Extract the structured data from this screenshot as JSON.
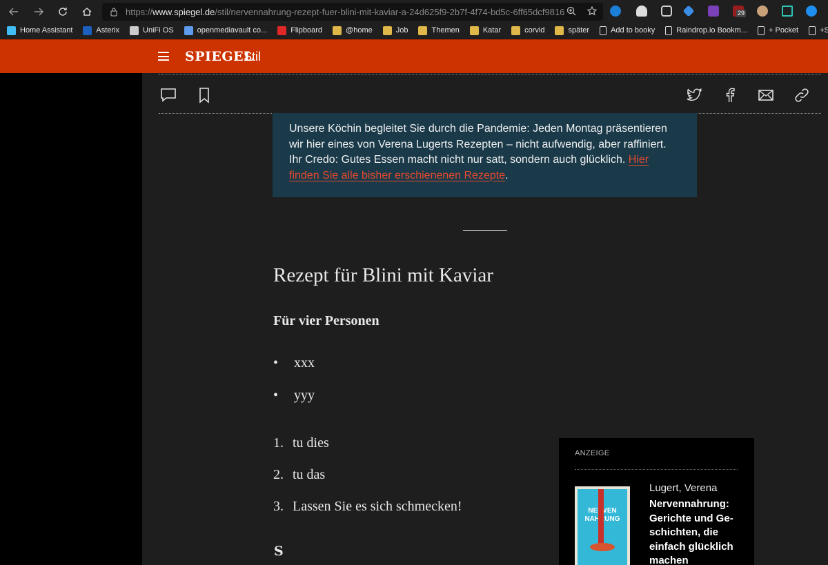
{
  "browser": {
    "url_prefix": "https://",
    "url_host": "www.spiegel.de",
    "url_path": "/stil/nervennahrung-rezept-fuer-blini-mit-kaviar-a-24d625f9-2b7f-4f74-bd5c-6ff65dcf9816",
    "extension_badge": "29"
  },
  "bookmarks": [
    {
      "label": "Home Assistant",
      "icon": "home-assistant-icon",
      "color": "#41bdf5"
    },
    {
      "label": "Asterix",
      "icon": "dsm-icon",
      "color": "#1d5fbf"
    },
    {
      "label": "UniFi OS",
      "icon": "unifi-icon",
      "color": "#cccccc"
    },
    {
      "label": "openmediavault co...",
      "icon": "openmediavault-icon",
      "color": "#5d9cec"
    },
    {
      "label": "Flipboard",
      "icon": "flipboard-icon",
      "color": "#e12828"
    },
    {
      "label": "@home",
      "icon": "folder-icon",
      "color": "#e0b84a"
    },
    {
      "label": "Job",
      "icon": "folder-icon",
      "color": "#e0b84a"
    },
    {
      "label": "Themen",
      "icon": "folder-icon",
      "color": "#e0b84a"
    },
    {
      "label": "Katar",
      "icon": "folder-icon",
      "color": "#e0b84a"
    },
    {
      "label": "corvid",
      "icon": "folder-icon",
      "color": "#e0b84a"
    },
    {
      "label": "später",
      "icon": "folder-icon",
      "color": "#e0b84a"
    },
    {
      "label": "Add to booky",
      "icon": "page-icon",
      "color": "#dddddd"
    },
    {
      "label": "Raindrop.io Bookm...",
      "icon": "page-icon",
      "color": "#dddddd"
    },
    {
      "label": "+ Pocket",
      "icon": "page-icon",
      "color": "#dddddd"
    },
    {
      "label": "+Start.me",
      "icon": "page-icon",
      "color": "#dddddd"
    }
  ],
  "header": {
    "logo": "SPIEGEL",
    "section": "Stil",
    "brand_color": "#cc3300"
  },
  "infobox": {
    "text": "Unsere Köchin begleitet Sie durch die Pandemie: Jeden Montag präsentieren wir hier eines von Verena Lugerts Rezepten – nicht aufwendig, aber raffiniert. Ihr Credo: Gutes Essen macht nicht nur satt, sondern auch glücklich. ",
    "link": "Hier finden Sie alle bisher erschienenen Rezepte",
    "tail": "."
  },
  "article": {
    "recipe_title": "Rezept für Blini mit Kaviar",
    "servings": "Für vier Personen",
    "ingredients": [
      "xxx",
      "yyy"
    ],
    "steps": [
      "tu dies",
      "tu das",
      "Lassen Sie es sich schmecken!"
    ],
    "end_mark": "S"
  },
  "ad": {
    "label": "ANZEIGE",
    "author": "Lugert, Verena",
    "title": "Nervennahrung: Gerichte und Ge-schichten, die einfach glücklich machen",
    "book_cover_text": "NERVEN NAHRUNG"
  }
}
